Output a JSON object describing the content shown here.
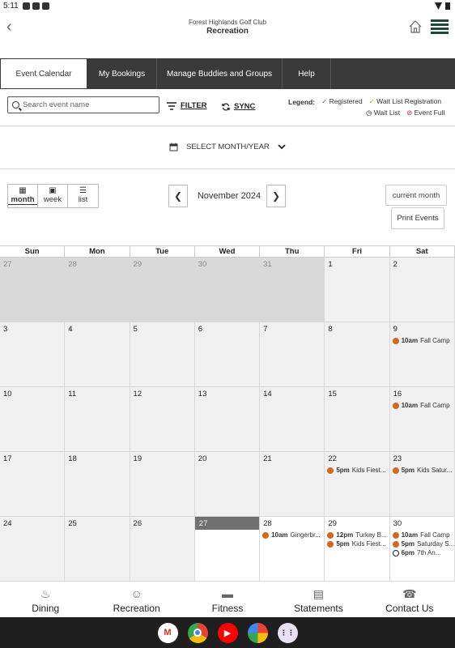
{
  "status_bar": {
    "time": "5:11"
  },
  "header": {
    "club_name": "Forest Highlands Golf Club",
    "section": "Recreation"
  },
  "tabs": [
    {
      "label": "Event Calendar",
      "active": true
    },
    {
      "label": "My Bookings",
      "active": false
    },
    {
      "label": "Manage Buddies and Groups",
      "active": false
    },
    {
      "label": "Help",
      "active": false
    }
  ],
  "toolbar": {
    "search_placeholder": "Search event name",
    "filter_label": "FILTER",
    "sync_label": "SYNC"
  },
  "legend": {
    "title": "Legend:",
    "registered": "Registered",
    "wait_list_registration": "Wait List Registration",
    "wait_list": "Wait List",
    "event_full": "Event Full"
  },
  "select_month_label": "SELECT MONTH/YEAR",
  "views": {
    "month": "month",
    "week": "week",
    "list": "list"
  },
  "calendar": {
    "month_label": "November 2024",
    "current_month_label": "current month",
    "print_label": "Print Events",
    "day_names": [
      "Sun",
      "Mon",
      "Tue",
      "Wed",
      "Thu",
      "Fri",
      "Sat"
    ],
    "weeks": [
      [
        {
          "day": "27",
          "kind": "prev",
          "events": []
        },
        {
          "day": "28",
          "kind": "prev",
          "events": []
        },
        {
          "day": "29",
          "kind": "prev",
          "events": []
        },
        {
          "day": "30",
          "kind": "prev",
          "events": []
        },
        {
          "day": "31",
          "kind": "prev",
          "events": []
        },
        {
          "day": "1",
          "kind": "cur",
          "events": []
        },
        {
          "day": "2",
          "kind": "cur",
          "events": []
        }
      ],
      [
        {
          "day": "3",
          "kind": "cur",
          "events": []
        },
        {
          "day": "4",
          "kind": "cur",
          "events": []
        },
        {
          "day": "5",
          "kind": "cur",
          "events": []
        },
        {
          "day": "6",
          "kind": "cur",
          "events": []
        },
        {
          "day": "7",
          "kind": "cur",
          "events": []
        },
        {
          "day": "8",
          "kind": "cur",
          "events": []
        },
        {
          "day": "9",
          "kind": "cur",
          "events": [
            {
              "time": "10am",
              "title": "Fall Camp",
              "marker": "dot"
            }
          ]
        }
      ],
      [
        {
          "day": "10",
          "kind": "cur",
          "events": []
        },
        {
          "day": "11",
          "kind": "cur",
          "events": []
        },
        {
          "day": "12",
          "kind": "cur",
          "events": []
        },
        {
          "day": "13",
          "kind": "cur",
          "events": []
        },
        {
          "day": "14",
          "kind": "cur",
          "events": []
        },
        {
          "day": "15",
          "kind": "cur",
          "events": []
        },
        {
          "day": "16",
          "kind": "cur",
          "events": [
            {
              "time": "10am",
              "title": "Fall Camp",
              "marker": "dot"
            }
          ]
        }
      ],
      [
        {
          "day": "17",
          "kind": "cur",
          "events": []
        },
        {
          "day": "18",
          "kind": "cur",
          "events": []
        },
        {
          "day": "19",
          "kind": "cur",
          "events": []
        },
        {
          "day": "20",
          "kind": "cur",
          "events": []
        },
        {
          "day": "21",
          "kind": "cur",
          "events": []
        },
        {
          "day": "22",
          "kind": "cur",
          "events": [
            {
              "time": "5pm",
              "title": "Kids Fiest...",
              "marker": "dot"
            }
          ]
        },
        {
          "day": "23",
          "kind": "cur",
          "events": [
            {
              "time": "5pm",
              "title": "Kids Satur...",
              "marker": "dot"
            }
          ]
        }
      ],
      [
        {
          "day": "24",
          "kind": "cur",
          "events": []
        },
        {
          "day": "25",
          "kind": "cur",
          "events": []
        },
        {
          "day": "26",
          "kind": "cur",
          "events": []
        },
        {
          "day": "27",
          "kind": "today",
          "events": []
        },
        {
          "day": "28",
          "kind": "future",
          "events": [
            {
              "time": "10am",
              "title": "Gingerbr...",
              "marker": "dot"
            }
          ]
        },
        {
          "day": "29",
          "kind": "future",
          "events": [
            {
              "time": "12pm",
              "title": "Turkey B...",
              "marker": "dot"
            },
            {
              "time": "5pm",
              "title": "Kids Fiest...",
              "marker": "dot"
            }
          ]
        },
        {
          "day": "30",
          "kind": "future",
          "events": [
            {
              "time": "10am",
              "title": "Fall Camp",
              "marker": "dot"
            },
            {
              "time": "5pm",
              "title": "Saturday S...",
              "marker": "dot"
            },
            {
              "time": "6pm",
              "title": "7th An...",
              "marker": "clock"
            }
          ]
        }
      ]
    ]
  },
  "bottom_nav": [
    {
      "label": "Dining",
      "icon": "dining-icon"
    },
    {
      "label": "Recreation",
      "icon": "recreation-icon"
    },
    {
      "label": "Fitness",
      "icon": "fitness-icon"
    },
    {
      "label": "Statements",
      "icon": "statements-icon"
    },
    {
      "label": "Contact Us",
      "icon": "contact-phone-icon"
    }
  ],
  "dock_apps": [
    "gmail-icon",
    "chrome-icon",
    "youtube-icon",
    "photos-icon",
    "app-drawer-icon"
  ],
  "colors": {
    "tab_bar": "#3a3a3a",
    "event_dot": "#d2691e",
    "prev_month_cell": "#d9d9d9",
    "today_header": "#6f6f6f",
    "menu_brand": "#1d4a36"
  }
}
